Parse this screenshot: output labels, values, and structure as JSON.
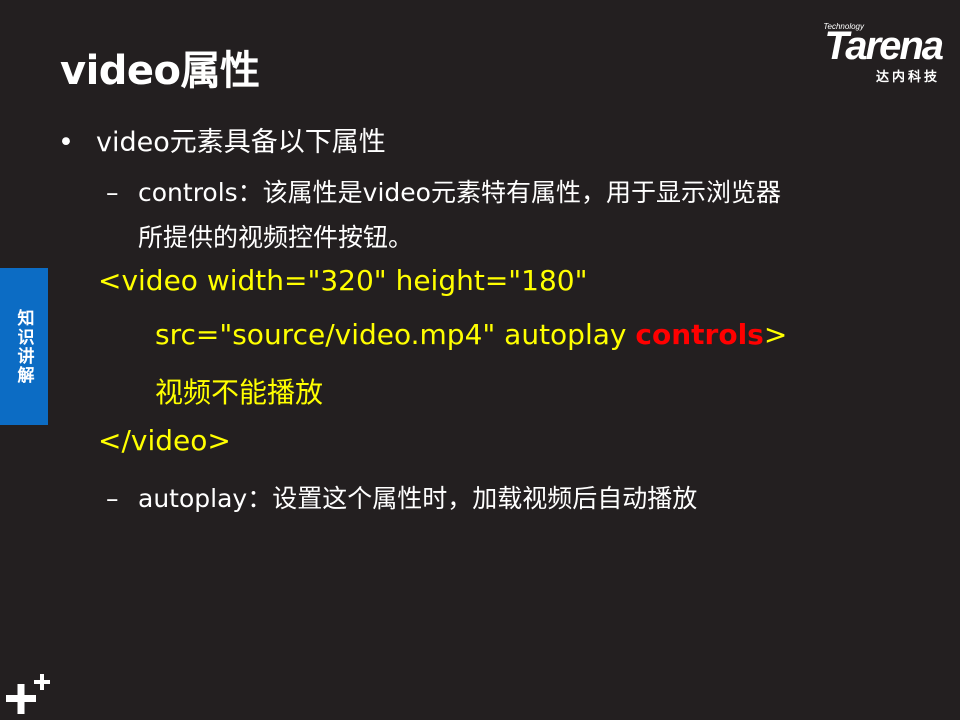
{
  "slide": {
    "title": "video属性"
  },
  "logo": {
    "tagline": "Technology",
    "wordmark": "Tarena",
    "subtitle": "达内科技"
  },
  "side_tab": {
    "label": "知识讲解"
  },
  "content": {
    "bullet1": "video元素具备以下属性",
    "sub1_line1": "controls：该属性是video元素特有属性，用于显示浏览器",
    "sub1_line2": "所提供的视频控件按钮。",
    "code_line1": "<video width=\"320\" height=\"180\"",
    "code_line2_prefix": "src=\"source/video.mp4\" autoplay ",
    "code_line2_highlight": "controls",
    "code_line2_suffix": ">",
    "code_line3": "视频不能播放",
    "code_line4": "</video>",
    "sub2": "autoplay：设置这个属性时，加载视频后自动播放"
  },
  "colors": {
    "background": "#231f20",
    "code": "#ffff00",
    "highlight": "#ff0000",
    "side_tab": "#0c6cc4"
  },
  "icons": {
    "corner": "plus-plus-icon",
    "bullet": "bullet-dot-icon"
  }
}
